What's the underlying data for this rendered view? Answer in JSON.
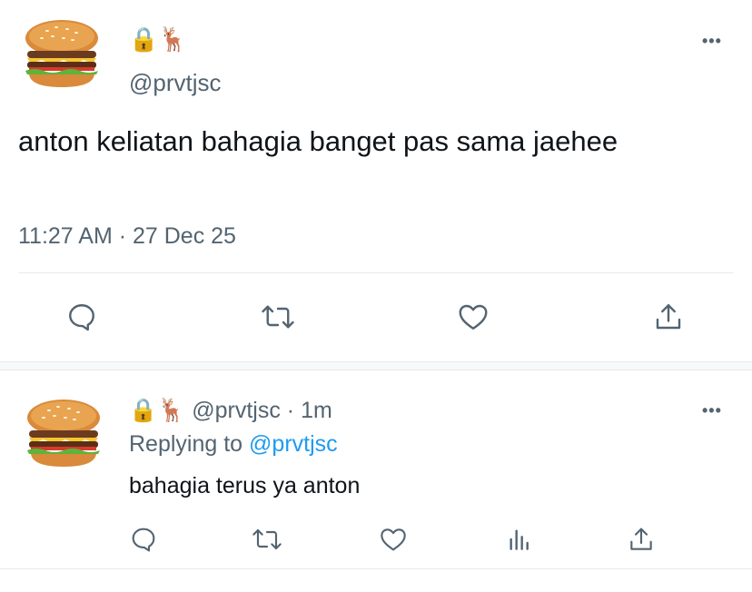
{
  "tweet": {
    "emojis": "🔒🦌",
    "handle": "@prvtjsc",
    "text": "anton keliatan bahagia banget pas sama jaehee",
    "timestamp": "11:27 AM · 27 Dec 25",
    "more_label": "•••"
  },
  "tweet_actions": [
    "reply-icon",
    "retweet-icon",
    "like-icon",
    "share-icon"
  ],
  "reply": {
    "emojis": "🔒🦌",
    "handle": "@prvtjsc",
    "separator": "·",
    "age": "1m",
    "replying_prefix": "Replying to",
    "replying_to": "@prvtjsc",
    "text": "bahagia terus ya anton",
    "more_label": "•••"
  },
  "reply_actions": [
    "reply-icon",
    "retweet-icon",
    "like-icon",
    "analytics-icon",
    "share-icon"
  ],
  "colors": {
    "accent": "#1d9bf0",
    "muted": "#536471",
    "text": "#0f1419",
    "divider": "#e6e9ec"
  }
}
